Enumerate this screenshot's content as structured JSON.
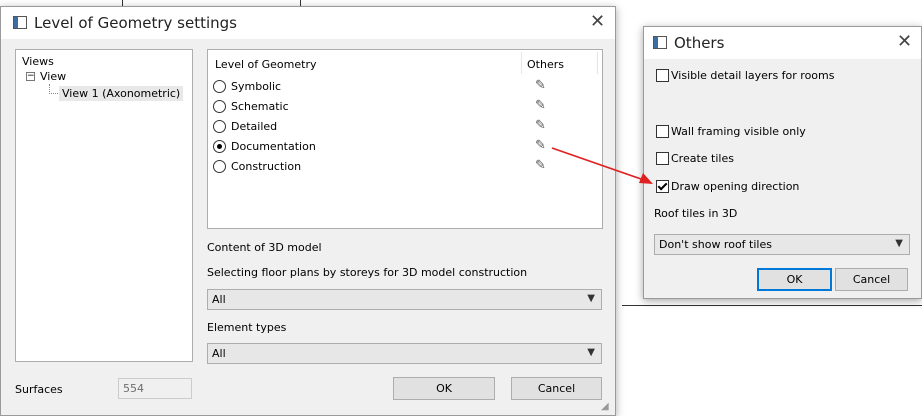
{
  "main_dialog": {
    "title": "Level of Geometry settings",
    "tree": {
      "header": "Views",
      "node_label": "View",
      "leaf_label": "View 1 (Axonometric)"
    },
    "lod_table": {
      "col_level": "Level of Geometry",
      "col_others": "Others",
      "rows": [
        {
          "label": "Symbolic",
          "selected": false
        },
        {
          "label": "Schematic",
          "selected": false
        },
        {
          "label": "Detailed",
          "selected": false
        },
        {
          "label": "Documentation",
          "selected": true
        },
        {
          "label": "Construction",
          "selected": false
        }
      ]
    },
    "content_label": "Content of 3D model",
    "floorplans_label": "Selecting floor plans by storeys for 3D model construction",
    "floorplans_value": "All",
    "element_types_label": "Element types",
    "element_types_value": "All",
    "surfaces_label": "Surfaces",
    "surfaces_value": "554",
    "ok_label": "OK",
    "cancel_label": "Cancel"
  },
  "others_dialog": {
    "title": "Others",
    "options": [
      {
        "label": "Visible detail layers for rooms",
        "checked": false
      },
      {
        "label": "Wall framing visible only",
        "checked": false
      },
      {
        "label": "Create tiles",
        "checked": false
      },
      {
        "label": "Draw opening direction",
        "checked": true
      }
    ],
    "roof_tiles_label": "Roof tiles in 3D",
    "roof_tiles_value": "Don't show roof tiles",
    "ok_label": "OK",
    "cancel_label": "Cancel"
  },
  "colors": {
    "arrow": "#e02020",
    "focus": "#0078d7"
  }
}
